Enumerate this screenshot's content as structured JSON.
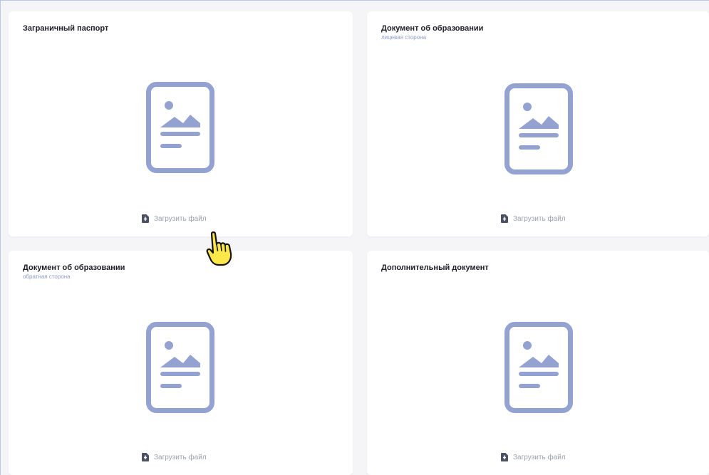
{
  "cards": [
    {
      "title": "Заграничный паспорт",
      "subtitle": "",
      "upload_label": "Загрузить файл"
    },
    {
      "title": "Документ об образовании",
      "subtitle": "лицевая сторона",
      "upload_label": "Загрузить файл"
    },
    {
      "title": "Документ об образовании",
      "subtitle": "обратная сторона",
      "upload_label": "Загрузить файл"
    },
    {
      "title": "Дополнительный документ",
      "subtitle": "",
      "upload_label": "Загрузить файл"
    }
  ],
  "icons": {
    "placeholder": "document-image-icon",
    "upload": "file-upload-icon",
    "cursor": "hand-pointer-icon"
  },
  "colors": {
    "icon_accent": "#94a2d2",
    "subtitle": "#8e9ccc",
    "upload_text": "#9aa0ae",
    "upload_icon": "#4b5263",
    "page_background": "#f5f5f7",
    "card_background": "#ffffff",
    "cursor_fill": "#fde84a"
  }
}
